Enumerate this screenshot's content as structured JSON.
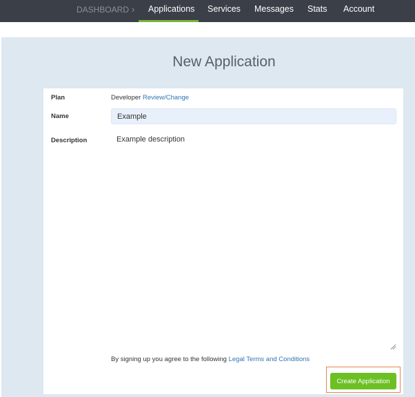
{
  "nav": {
    "dashboard": "DASHBOARD",
    "items": [
      "Applications",
      "Services",
      "Messages",
      "Stats",
      "Account"
    ],
    "active": "Applications"
  },
  "page": {
    "title": "New Application"
  },
  "form": {
    "plan_label": "Plan",
    "plan_value": "Developer",
    "plan_link": "Review/Change",
    "name_label": "Name",
    "name_value": "Example",
    "description_label": "Description",
    "description_value": "Example description",
    "terms_text": "By signing up you agree to the following",
    "terms_link": "Legal Terms and Conditions",
    "submit_label": "Create Application"
  },
  "colors": {
    "nav_bg": "#3b3f48",
    "accent": "#7ab33a",
    "button": "#6cc024",
    "link": "#2f74b5",
    "panel_bg": "#dde8f1",
    "highlight": "#e8854a"
  }
}
